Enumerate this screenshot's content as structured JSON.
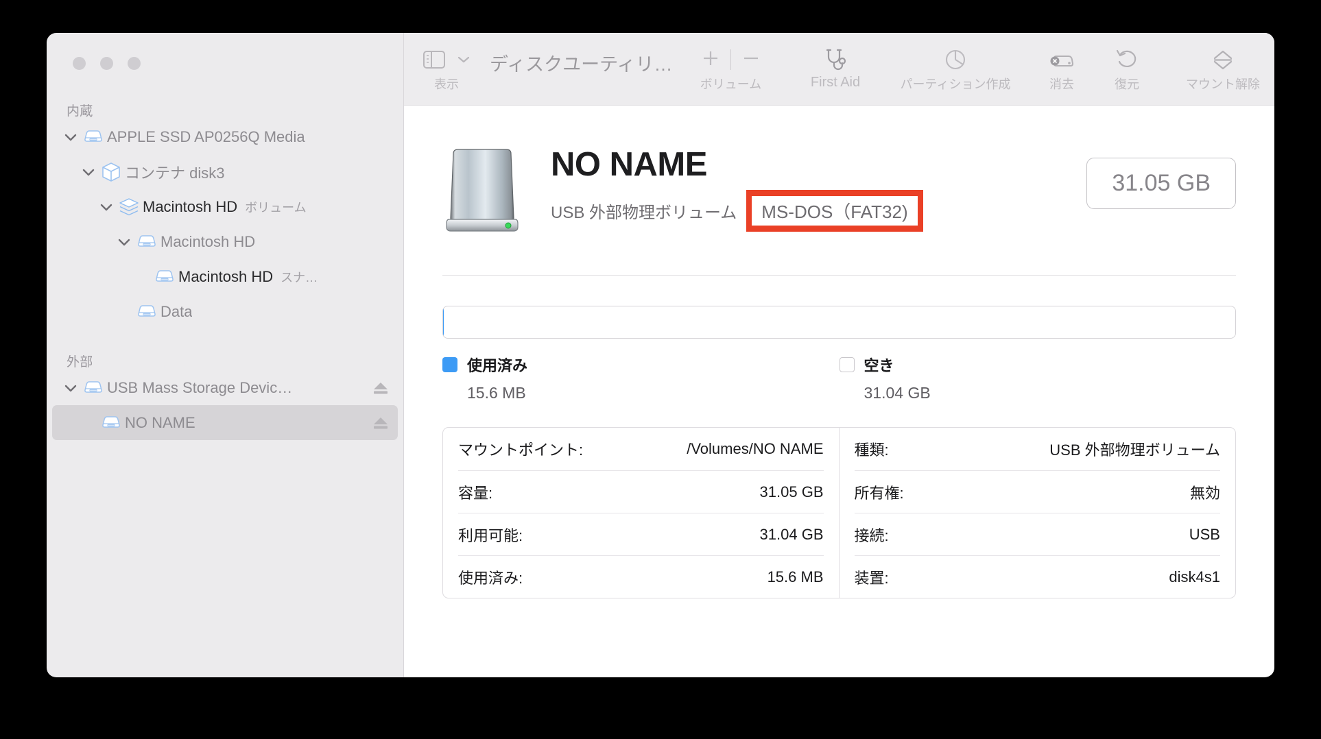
{
  "window": {
    "traffic_lights": [
      "close",
      "minimize",
      "zoom"
    ]
  },
  "toolbar": {
    "view_label": "表示",
    "title": "ディスクユーティリ…",
    "volume_label": "ボリューム",
    "volume_add": "+",
    "volume_remove": "—",
    "first_aid_label": "First Aid",
    "partition_label": "パーティション作成",
    "erase_label": "消去",
    "restore_label": "復元",
    "unmount_label": "マウント解除",
    "overflow_label": "»"
  },
  "sidebar": {
    "sections": [
      {
        "title": "内蔵",
        "items": [
          {
            "label": "APPLE SSD AP0256Q Media",
            "sub": "",
            "icon": "disk-icon",
            "depth": 0,
            "twisty": "down",
            "selected": false,
            "eject": false,
            "dark": false
          },
          {
            "label": "コンテナ disk3",
            "sub": "",
            "icon": "container-icon",
            "depth": 1,
            "twisty": "down",
            "selected": false,
            "eject": false,
            "dark": false
          },
          {
            "label": "Macintosh HD",
            "sub": "ボリューム",
            "icon": "volume-icon",
            "depth": 2,
            "twisty": "down",
            "selected": false,
            "eject": false,
            "dark": true
          },
          {
            "label": "Macintosh HD",
            "sub": "",
            "icon": "disk-icon",
            "depth": 3,
            "twisty": "down",
            "selected": false,
            "eject": false,
            "dark": false
          },
          {
            "label": "Macintosh HD",
            "sub": "スナ…",
            "icon": "disk-icon",
            "depth": 4,
            "twisty": "none",
            "selected": false,
            "eject": false,
            "dark": true
          },
          {
            "label": "Data",
            "sub": "",
            "icon": "disk-icon",
            "depth": 3,
            "twisty": "none",
            "selected": false,
            "eject": false,
            "dark": false
          }
        ]
      },
      {
        "title": "外部",
        "items": [
          {
            "label": "USB Mass Storage Devic…",
            "sub": "",
            "icon": "disk-icon",
            "depth": 0,
            "twisty": "down",
            "selected": false,
            "eject": true,
            "dark": false
          },
          {
            "label": "NO NAME",
            "sub": "",
            "icon": "disk-icon",
            "depth": 1,
            "twisty": "none",
            "selected": true,
            "eject": true,
            "dark": false
          }
        ]
      }
    ]
  },
  "main": {
    "volume_name": "NO NAME",
    "volume_kind": "USB 外部物理ボリューム",
    "format": "MS-DOS（FAT32)",
    "format_highlight_color": "#ea4026",
    "capacity_badge": "31.05 GB",
    "usage": {
      "used_percent": 0.05,
      "used_color": "#3d9bf5",
      "free_color": "#ffffff",
      "legend": [
        {
          "label": "使用済み",
          "value": "15.6 MB",
          "swatch": "used"
        },
        {
          "label": "空き",
          "value": "31.04 GB",
          "swatch": "free"
        }
      ]
    },
    "info_left": [
      {
        "key": "マウントポイント:",
        "value": "/Volumes/NO NAME"
      },
      {
        "key": "容量:",
        "value": "31.05 GB"
      },
      {
        "key": "利用可能:",
        "value": "31.04 GB"
      },
      {
        "key": "使用済み:",
        "value": "15.6 MB"
      }
    ],
    "info_right": [
      {
        "key": "種類:",
        "value": "USB 外部物理ボリューム"
      },
      {
        "key": "所有権:",
        "value": "無効"
      },
      {
        "key": "接続:",
        "value": "USB"
      },
      {
        "key": "装置:",
        "value": "disk4s1"
      }
    ]
  }
}
